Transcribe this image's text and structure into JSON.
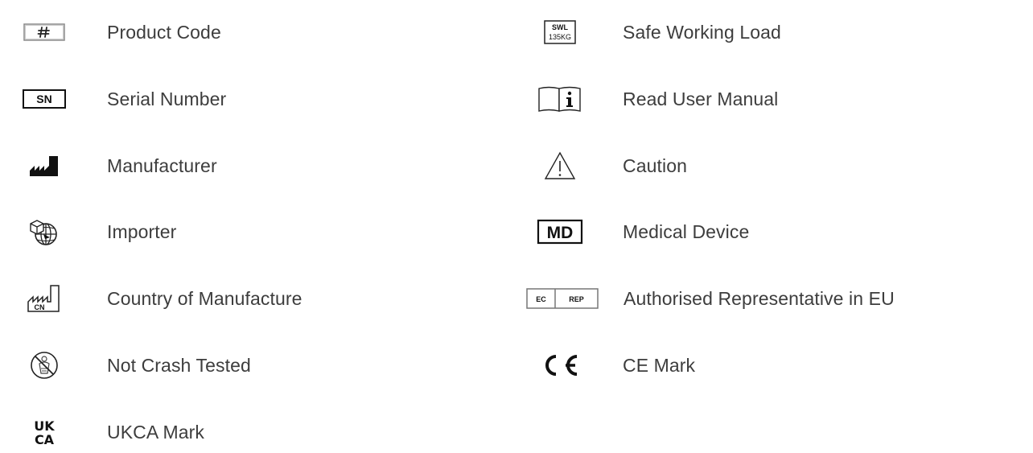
{
  "left_column": [
    {
      "icon": "hash-box-icon",
      "label": "Product Code"
    },
    {
      "icon": "serial-number-icon",
      "label": "Serial Number",
      "icon_text": "SN"
    },
    {
      "icon": "manufacturer-factory-icon",
      "label": "Manufacturer"
    },
    {
      "icon": "importer-globe-icon",
      "label": "Importer"
    },
    {
      "icon": "country-of-manufacture-icon",
      "label": "Country of Manufacture",
      "icon_text": "CN"
    },
    {
      "icon": "not-crash-tested-icon",
      "label": "Not Crash Tested"
    },
    {
      "icon": "ukca-mark-icon",
      "label": "UKCA Mark",
      "icon_text": [
        "UK",
        "CA"
      ]
    }
  ],
  "right_column": [
    {
      "icon": "safe-working-load-icon",
      "label": "Safe Working Load",
      "icon_text": [
        "SWL",
        "135KG"
      ]
    },
    {
      "icon": "user-manual-info-icon",
      "label": "Read User Manual"
    },
    {
      "icon": "caution-triangle-icon",
      "label": "Caution"
    },
    {
      "icon": "medical-device-icon",
      "label": "Medical Device",
      "icon_text": "MD"
    },
    {
      "icon": "ec-rep-icon",
      "label": "Authorised Representative in EU",
      "icon_text": [
        "EC",
        "REP"
      ]
    },
    {
      "icon": "ce-mark-icon",
      "label": "CE Mark"
    }
  ]
}
